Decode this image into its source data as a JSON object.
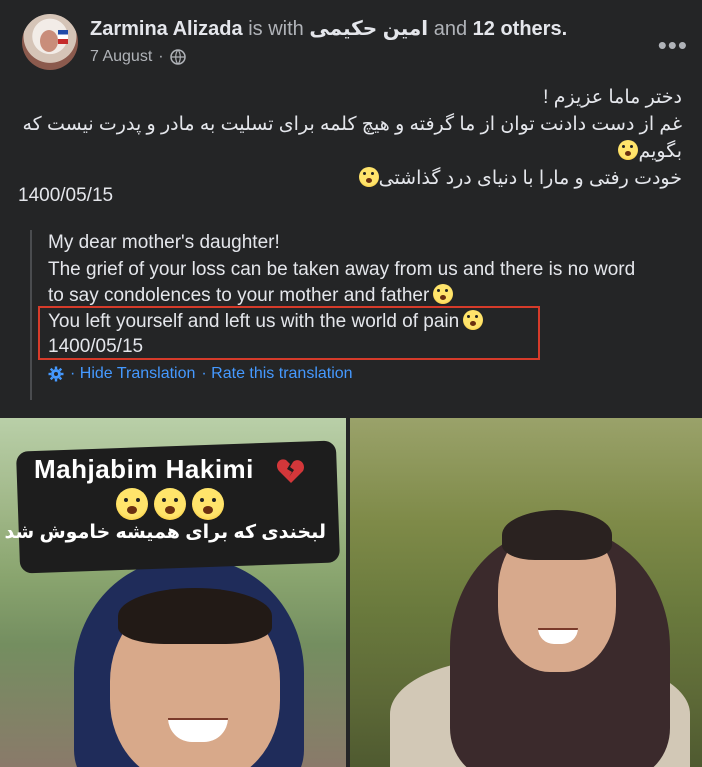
{
  "post": {
    "author": "Zarmina Alizada",
    "with_text": "is with",
    "tagged_name": "امین حکیمی",
    "and_text": "and",
    "others": "12 others.",
    "date": "7 August",
    "separator": "·",
    "privacy_icon": "globe-icon",
    "more_icon": "more-options-icon",
    "more_label": "•••"
  },
  "original_text": {
    "line1": "دختر ماما عزیزم !",
    "line2": "غم از دست دادنت توان از ما گرفته و هیچ کلمه برای تسلیت به مادر و پدرت نیست که",
    "line3": "بگویم",
    "line4": "خودت رفتی و مارا با دنیای درد گذاشتی",
    "date": "1400/05/15"
  },
  "translation": {
    "line1": "My dear mother's daughter!",
    "line2": "The grief of your loss can be taken away from us and there is no word",
    "line3": "to say condolences to your mother and father",
    "line4": "You left yourself and left us with the world of pain",
    "line5": "1400/05/15",
    "settings_icon": "gear-icon",
    "hide_label": "· Hide Translation",
    "rate_label": "· Rate this translation"
  },
  "photos": {
    "sticker_title": "Mahjabim Hakimi",
    "sticker_subtitle": "لبخندی که برای همیشه خاموش شد",
    "sticker_icon": "broken-heart-icon"
  },
  "colors": {
    "background": "#242526",
    "link": "#4599ff",
    "highlight_border": "#d63b2a"
  }
}
